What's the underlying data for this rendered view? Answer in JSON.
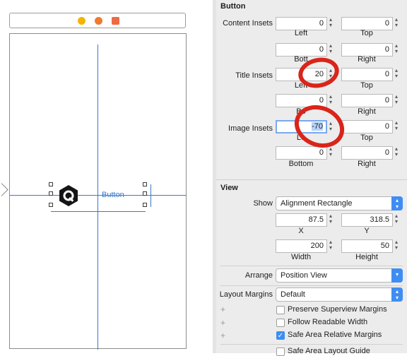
{
  "inspector": {
    "button_section": {
      "title": "Button",
      "content_insets": {
        "label": "Content Insets",
        "left": "0",
        "top": "0",
        "bottom": "0",
        "right": "0"
      },
      "title_insets": {
        "label": "Title Insets",
        "left": "20",
        "top": "0",
        "bottom": "0",
        "right": "0"
      },
      "image_insets": {
        "label": "Image Insets",
        "left": "-70",
        "top": "0",
        "bottom": "0",
        "right": "0"
      },
      "sub_labels": {
        "left": "Left",
        "top": "Top",
        "bottom": "Bottom",
        "right": "Right"
      },
      "clipped_sub_labels": {
        "content_bottom": "Bott",
        "title_bottom": "Bo",
        "image_left": "Le"
      }
    },
    "view_section": {
      "title": "View",
      "show": {
        "label": "Show",
        "value": "Alignment Rectangle"
      },
      "x": "87.5",
      "y": "318.5",
      "width": "200",
      "height": "50",
      "sub_labels": {
        "x": "X",
        "y": "Y",
        "width": "Width",
        "height": "Height"
      },
      "arrange": {
        "label": "Arrange",
        "value": "Position View"
      },
      "layout_margins": {
        "label": "Layout Margins",
        "value": "Default"
      },
      "checkboxes": [
        {
          "label": "Preserve Superview Margins",
          "checked": false
        },
        {
          "label": "Follow Readable Width",
          "checked": false
        },
        {
          "label": "Safe Area Relative Margins",
          "checked": true
        },
        {
          "label": "Safe Area Layout Guide",
          "checked": false
        }
      ]
    }
  },
  "canvas": {
    "button_title": "Button",
    "scene_icons": [
      "view-controller-icon",
      "first-responder-icon",
      "exit-icon"
    ]
  },
  "colors": {
    "guide": "#3a78c9",
    "annotation": "#d9251a",
    "accent": "#3f8df2"
  }
}
